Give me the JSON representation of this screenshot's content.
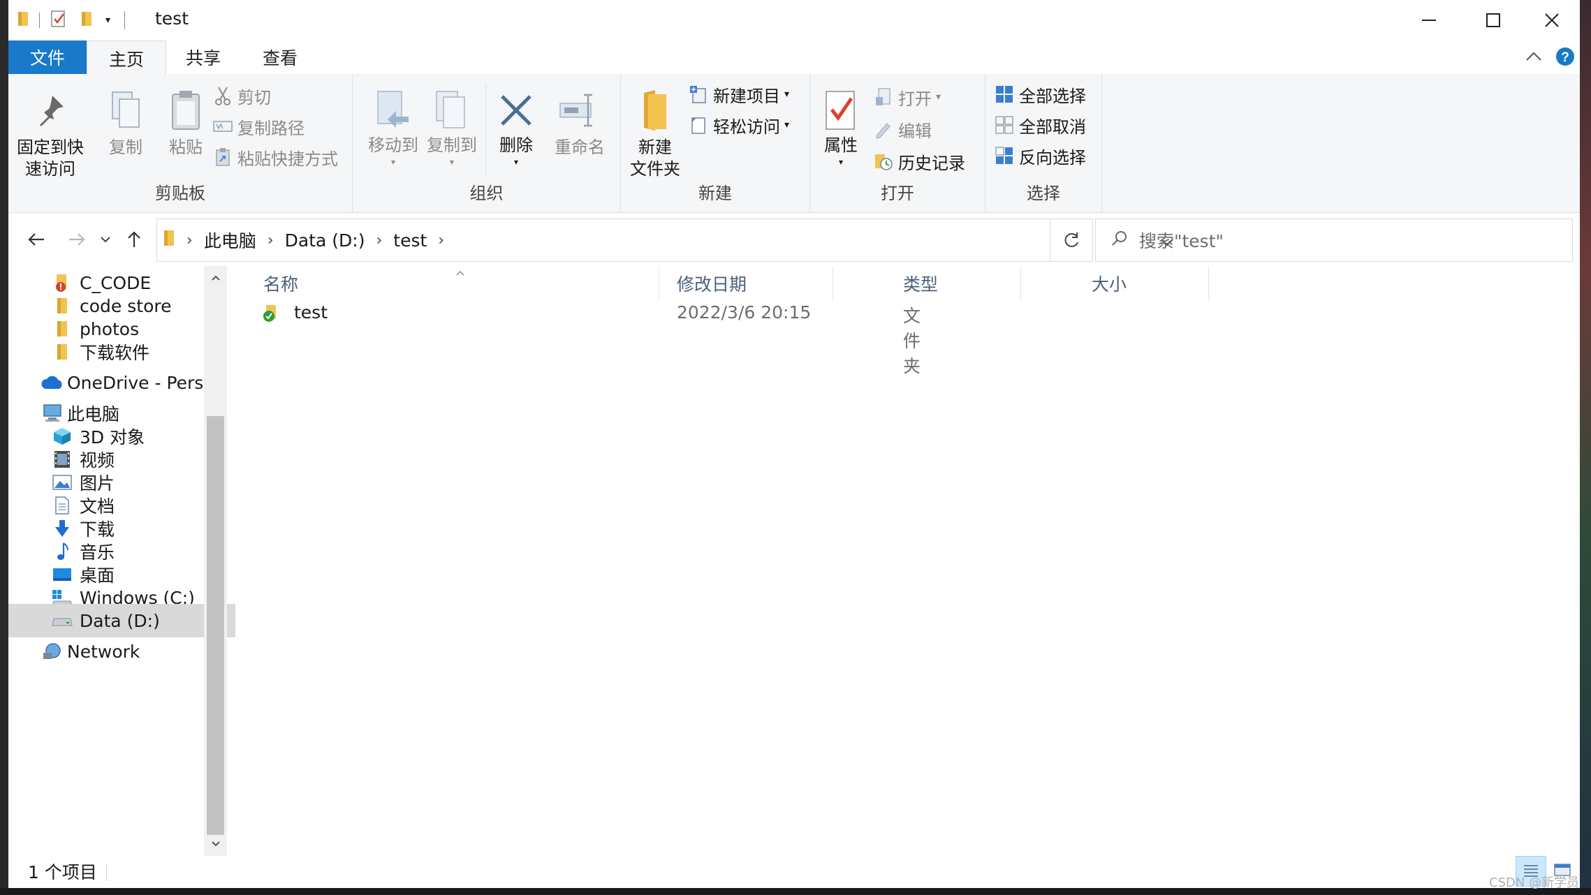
{
  "window": {
    "title": "test"
  },
  "title_buttons": {
    "minimize": "—",
    "maximize": "☐",
    "close": "✕"
  },
  "tabs": {
    "file": "文件",
    "home": "主页",
    "share": "共享",
    "view": "查看"
  },
  "ribbon": {
    "clipboard": {
      "label": "剪贴板",
      "pin_line1": "固定到快",
      "pin_line2": "速访问",
      "copy": "复制",
      "paste": "粘贴",
      "cut": "剪切",
      "copy_path": "复制路径",
      "paste_shortcut": "粘贴快捷方式"
    },
    "organize": {
      "label": "组织",
      "move_to": "移动到",
      "copy_to": "复制到",
      "delete": "删除",
      "rename": "重命名"
    },
    "new": {
      "label": "新建",
      "new_folder_line1": "新建",
      "new_folder_line2": "文件夹",
      "new_item": "新建项目",
      "easy_access": "轻松访问"
    },
    "open": {
      "label": "打开",
      "properties": "属性",
      "open": "打开",
      "edit": "编辑",
      "history": "历史记录"
    },
    "select": {
      "label": "选择",
      "select_all": "全部选择",
      "select_none": "全部取消",
      "invert": "反向选择"
    }
  },
  "address": {
    "crumbs": [
      "此电脑",
      "Data (D:)",
      "test"
    ],
    "search_placeholder": "搜索\"test\""
  },
  "nav": {
    "items": [
      {
        "label": "C_CODE",
        "icon": "folder-icon"
      },
      {
        "label": "code store",
        "icon": "folder-icon"
      },
      {
        "label": "photos",
        "icon": "folder-icon"
      },
      {
        "label": "下载软件",
        "icon": "folder-icon"
      },
      {
        "label": "OneDrive - Persc",
        "icon": "cloud-icon"
      },
      {
        "label": "此电脑",
        "icon": "computer-icon"
      },
      {
        "label": "3D 对象",
        "icon": "cube-icon"
      },
      {
        "label": "视频",
        "icon": "video-icon"
      },
      {
        "label": "图片",
        "icon": "pictures-icon"
      },
      {
        "label": "文档",
        "icon": "document-icon"
      },
      {
        "label": "下载",
        "icon": "download-icon"
      },
      {
        "label": "音乐",
        "icon": "music-icon"
      },
      {
        "label": "桌面",
        "icon": "desktop-icon"
      },
      {
        "label": "Windows (C:)",
        "icon": "drive-icon"
      },
      {
        "label": "Data (D:)",
        "icon": "drive-icon"
      },
      {
        "label": "Network",
        "icon": "network-icon"
      }
    ]
  },
  "columns": {
    "name": "名称",
    "modified": "修改日期",
    "type": "类型",
    "size": "大小"
  },
  "files": [
    {
      "name": "test",
      "modified": "2022/3/6 20:15",
      "type": "文件夹",
      "size": ""
    }
  ],
  "status": {
    "count": "1 个项目"
  },
  "watermark": "CSDN @新学员",
  "colors": {
    "accent": "#1979ca",
    "folder": "#f3c352",
    "selected": "#d9d9d9"
  }
}
